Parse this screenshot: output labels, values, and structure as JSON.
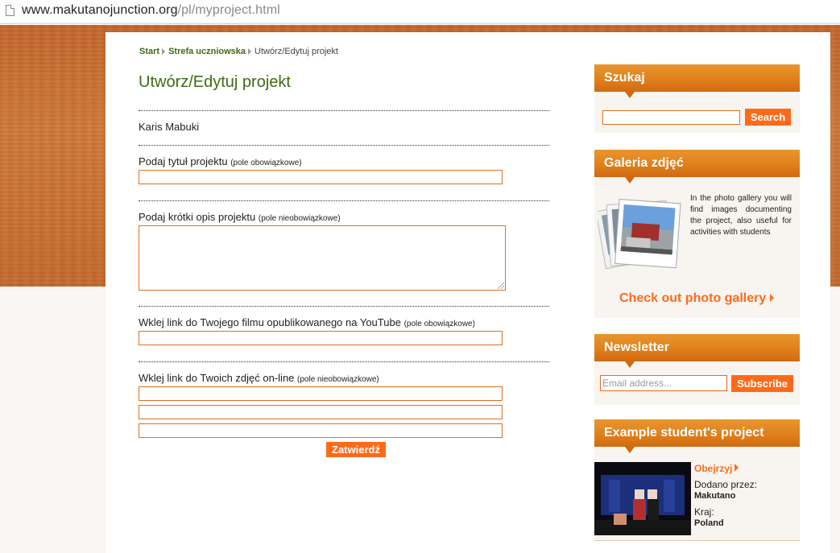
{
  "browser": {
    "url_host": "www.makutanojunction.org",
    "url_path": "/pl/myproject.html"
  },
  "breadcrumb": {
    "items": [
      "Start",
      "Strefa uczniowska",
      "Utwórz/Edytuj projekt"
    ]
  },
  "form": {
    "title": "Utwórz/Edytuj projekt",
    "user_name": "Karis Mabuki",
    "title_label": "Podaj tytuł projektu",
    "title_note": "(pole obowiązkowe)",
    "description_label": "Podaj krótki opis projektu",
    "description_note": "(pole nieobowiązkowe)",
    "youtube_label": "Wklej link do Twojego filmu opublikowanego na YouTube",
    "youtube_note": "(pole obowiązkowe)",
    "photos_label": "Wklej link do Twoich zdjęć on-line",
    "photos_note": "(pole nieobowiązkowe)",
    "submit_label": "Zatwierdź"
  },
  "sidebar": {
    "search": {
      "heading": "Szukaj",
      "button": "Search"
    },
    "gallery": {
      "heading": "Galeria zdjęć",
      "text": "In the photo gallery you will find images documenting the project, also useful for activities with students",
      "link": "Check out photo gallery"
    },
    "newsletter": {
      "heading": "Newsletter",
      "placeholder": "Email address...",
      "button": "Subscribe"
    },
    "example": {
      "heading": "Example student's project",
      "watch": "Obejrzyj",
      "added_by_label": "Dodano przez:",
      "added_by": "Makutano",
      "country_label": "Kraj:",
      "country": "Poland"
    }
  },
  "colors": {
    "accent": "#ff6a1a",
    "heading_green": "#3e6b10",
    "widget_header": "#e0801c",
    "background_wood": "#c86a2c"
  },
  "icons": [
    "page-icon",
    "breadcrumb-arrow-icon",
    "chevron-right-icon",
    "photo-stack-icon",
    "resize-grip-icon"
  ]
}
